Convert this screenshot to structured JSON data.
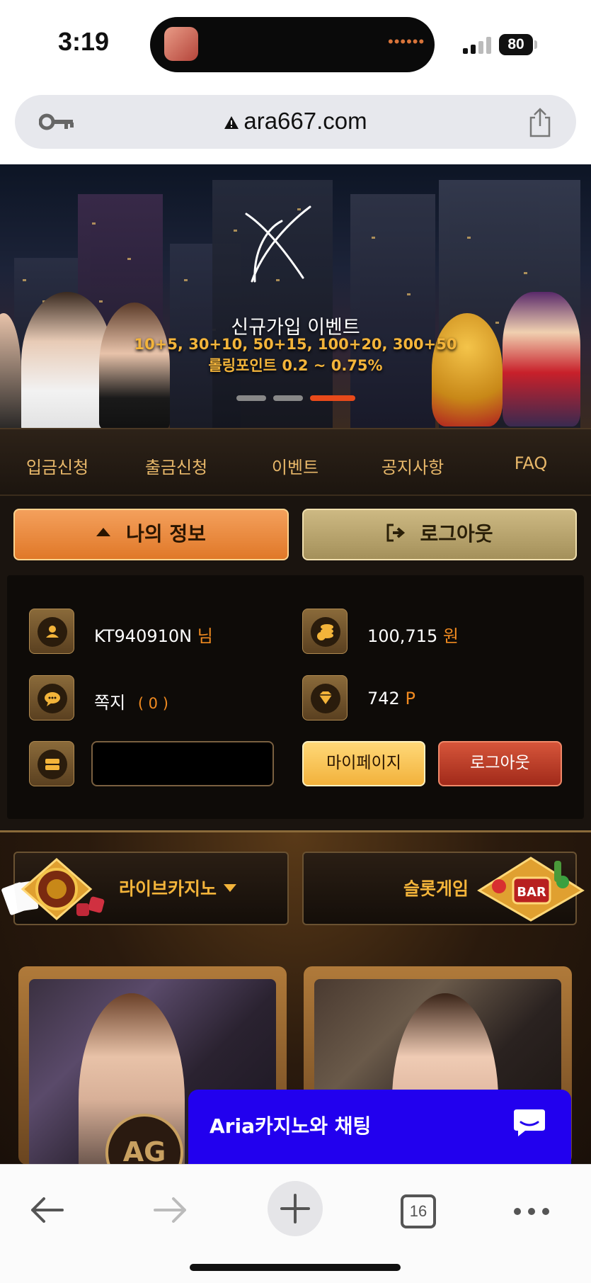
{
  "status_bar": {
    "time": "3:19",
    "dots": "••••••",
    "battery": "80"
  },
  "browser": {
    "url": "ara667.com",
    "tabs_count": "16"
  },
  "banner": {
    "title": "신규가입 이벤트",
    "subtitle": "10+5, 30+10, 50+15, 100+20, 300+50",
    "subtitle2": "롤링포인트 0.2 ~ 0.75%",
    "active_slide": 3,
    "slide_count": 3
  },
  "nav": {
    "items": [
      "입금신청",
      "출금신청",
      "이벤트",
      "공지사항",
      "FAQ"
    ]
  },
  "actions": {
    "my_info": "나의 정보",
    "logout": "로그아웃"
  },
  "account": {
    "username": "KT940910N",
    "username_suffix": "님",
    "balance": "100,715",
    "balance_unit": "원",
    "messages_label": "쪽지",
    "messages_count": "( 0 )",
    "points": "742",
    "points_unit": "P",
    "mypage_button": "마이페이지",
    "logout_button": "로그아웃"
  },
  "games": {
    "tab_live": "라이브카지노",
    "tab_slot": "슬롯게임"
  },
  "chat": {
    "label": "Aria카지노와 채팅"
  },
  "colors": {
    "accent": "#f08a20",
    "gold": "#f3b43a",
    "chat": "#2200ee"
  }
}
